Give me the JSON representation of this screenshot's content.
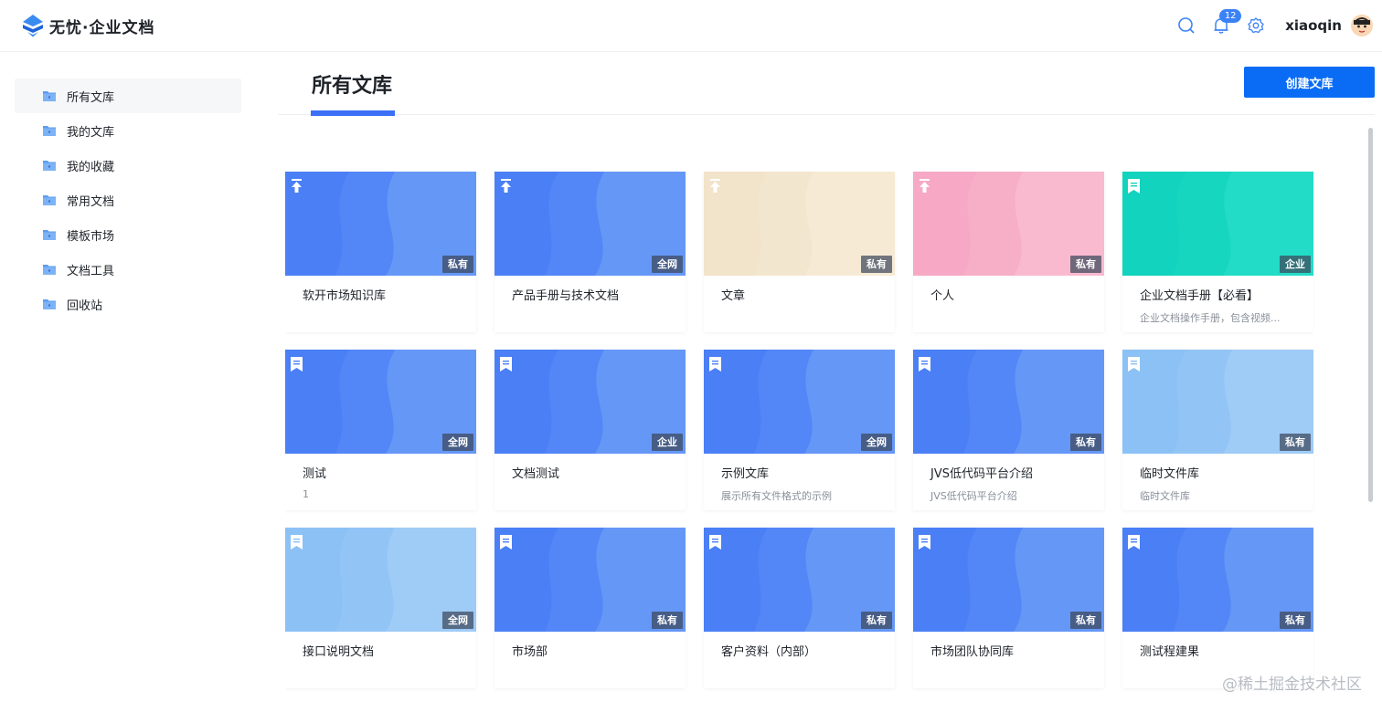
{
  "app": {
    "brand": "无忧·企业文档",
    "user": "xiaoqin",
    "notification_count": "12",
    "icons": [
      "search-icon",
      "bell-icon",
      "gear-icon"
    ]
  },
  "sidebar": {
    "items": [
      {
        "label": "所有文库",
        "active": true
      },
      {
        "label": "我的文库"
      },
      {
        "label": "我的收藏"
      },
      {
        "label": "常用文档"
      },
      {
        "label": "模板市场"
      },
      {
        "label": "文档工具"
      },
      {
        "label": "回收站"
      }
    ]
  },
  "main": {
    "title": "所有文库",
    "create_label": "创建文库"
  },
  "colors": {
    "blue": "#4a7ff5",
    "beige": "#f2e4ca",
    "pink": "#f7a8c4",
    "teal": "#12d3bd",
    "lightblue": "#8cc1f5",
    "accent": "#0a6cf5"
  },
  "libraries": [
    {
      "title": "软开市场知识库",
      "desc": "",
      "tag": "私有",
      "color": "blue",
      "icon": "pin-icon"
    },
    {
      "title": "产品手册与技术文档",
      "desc": "",
      "tag": "全网",
      "color": "blue",
      "icon": "pin-icon"
    },
    {
      "title": "文章",
      "desc": "",
      "tag": "私有",
      "color": "beige",
      "icon": "pin-icon"
    },
    {
      "title": "个人",
      "desc": "",
      "tag": "私有",
      "color": "pink",
      "icon": "pin-icon"
    },
    {
      "title": "企业文档手册【必看】",
      "desc": "企业文档操作手册，包含视频...",
      "tag": "企业",
      "color": "teal",
      "icon": "bookmark-icon"
    },
    {
      "title": "测试",
      "desc": "1",
      "tag": "全网",
      "color": "blue",
      "icon": "bookmark-icon"
    },
    {
      "title": "文档测试",
      "desc": "",
      "tag": "企业",
      "color": "blue",
      "icon": "bookmark-icon"
    },
    {
      "title": "示例文库",
      "desc": "展示所有文件格式的示例",
      "tag": "全网",
      "color": "blue",
      "icon": "bookmark-icon"
    },
    {
      "title": "JVS低代码平台介绍",
      "desc": "JVS低代码平台介绍",
      "tag": "私有",
      "color": "blue",
      "icon": "bookmark-icon"
    },
    {
      "title": "临时文件库",
      "desc": "临时文件库",
      "tag": "私有",
      "color": "lightblue",
      "icon": "bookmark-icon"
    },
    {
      "title": "接口说明文档",
      "desc": "",
      "tag": "全网",
      "color": "lightblue",
      "icon": "bookmark-icon"
    },
    {
      "title": "市场部",
      "desc": "",
      "tag": "私有",
      "color": "blue",
      "icon": "bookmark-icon"
    },
    {
      "title": "客户资料（内部）",
      "desc": "",
      "tag": "私有",
      "color": "blue",
      "icon": "bookmark-icon"
    },
    {
      "title": "市场团队协同库",
      "desc": "",
      "tag": "私有",
      "color": "blue",
      "icon": "bookmark-icon"
    },
    {
      "title": "测试程建果",
      "desc": "",
      "tag": "私有",
      "color": "blue",
      "icon": "bookmark-icon"
    }
  ],
  "watermark": "@稀土掘金技术社区"
}
